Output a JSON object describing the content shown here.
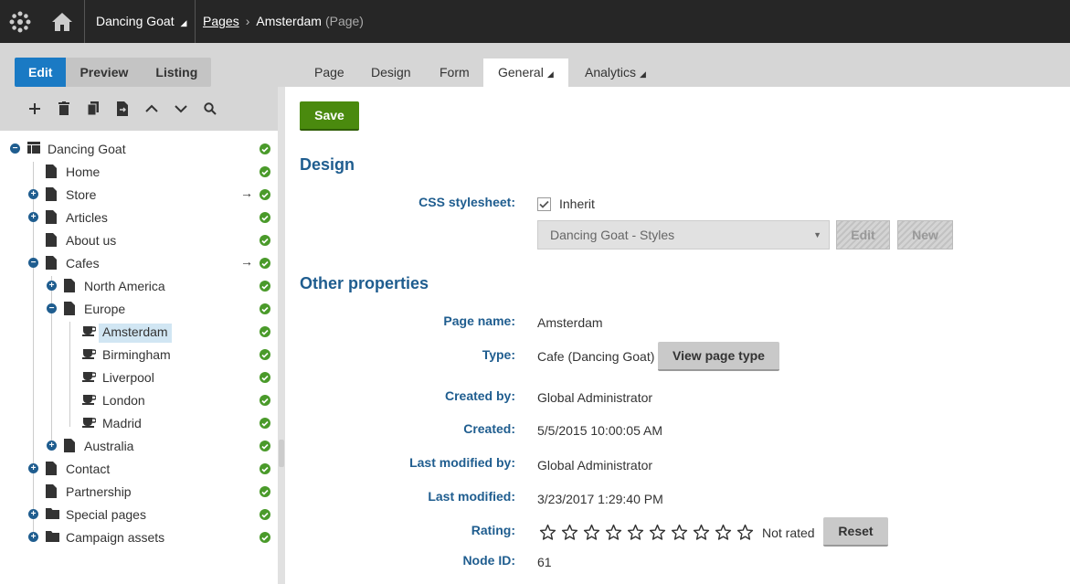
{
  "topbar": {
    "site_name": "Dancing Goat",
    "breadcrumb_root": "Pages",
    "breadcrumb_current": "Amsterdam",
    "breadcrumb_type": "(Page)"
  },
  "modes": {
    "edit": "Edit",
    "preview": "Preview",
    "listing": "Listing"
  },
  "toolbar": [
    "plus-icon",
    "trash-icon",
    "copy-icon",
    "move-icon",
    "up-icon",
    "down-icon",
    "search-icon"
  ],
  "tree": {
    "items": [
      {
        "label": "Dancing Goat"
      },
      {
        "label": "Home"
      },
      {
        "label": "Store"
      },
      {
        "label": "Articles"
      },
      {
        "label": "About us"
      },
      {
        "label": "Cafes"
      },
      {
        "label": "North America"
      },
      {
        "label": "Europe"
      },
      {
        "label": "Amsterdam"
      },
      {
        "label": "Birmingham"
      },
      {
        "label": "Liverpool"
      },
      {
        "label": "London"
      },
      {
        "label": "Madrid"
      },
      {
        "label": "Australia"
      },
      {
        "label": "Contact"
      },
      {
        "label": "Partnership"
      },
      {
        "label": "Special pages"
      },
      {
        "label": "Campaign assets"
      }
    ],
    "arrow": "→"
  },
  "tabs": {
    "page": "Page",
    "design": "Design",
    "form": "Form",
    "general": "General",
    "analytics": "Analytics"
  },
  "form": {
    "save_label": "Save",
    "design_heading": "Design",
    "css_label": "CSS stylesheet:",
    "inherit_label": "Inherit",
    "stylesheet_value": "Dancing Goat - Styles",
    "edit_label": "Edit",
    "new_label": "New",
    "other_heading": "Other properties",
    "page_name_label": "Page name:",
    "page_name_value": "Amsterdam",
    "type_label": "Type:",
    "type_value": "Cafe (Dancing Goat)",
    "view_type_label": "View page type",
    "created_by_label": "Created by:",
    "created_by_value": "Global Administrator",
    "created_label": "Created:",
    "created_value": "5/5/2015 10:00:05 AM",
    "modified_by_label": "Last modified by:",
    "modified_by_value": "Global Administrator",
    "modified_label": "Last modified:",
    "modified_value": "3/23/2017 1:29:40 PM",
    "rating_label": "Rating:",
    "rating_text": "Not rated",
    "reset_label": "Reset",
    "node_id_label": "Node ID:",
    "node_id_value": "61"
  },
  "colors": {
    "accent": "#1a7ac4",
    "heading": "#1f5d8f",
    "save": "#4a8a0e",
    "topbar": "#262626",
    "status_ok": "#4a9a2a"
  }
}
